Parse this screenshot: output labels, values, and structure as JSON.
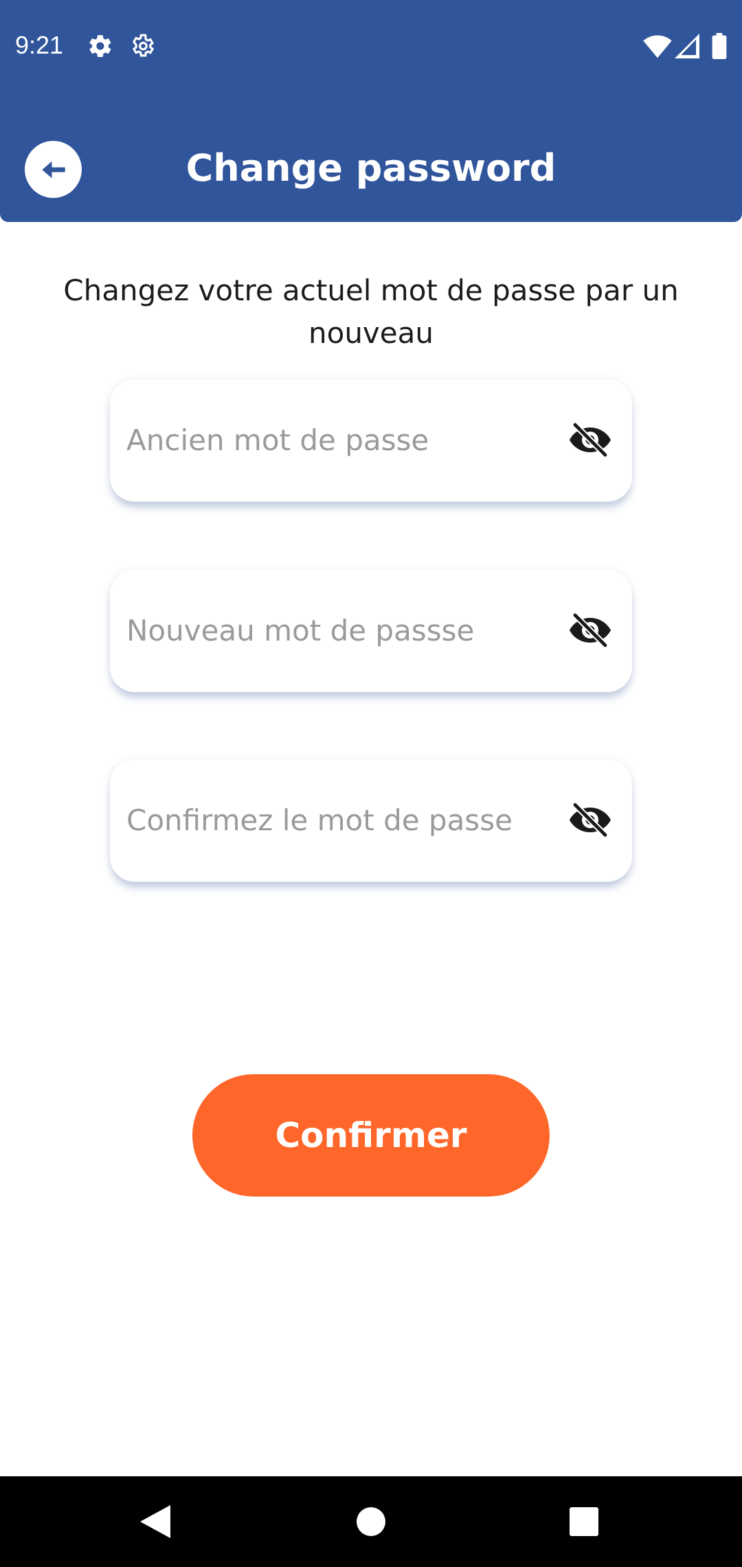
{
  "status_bar": {
    "time": "9:21",
    "left_icons": [
      "gear-icon",
      "settings-outline-icon"
    ],
    "right_icons": [
      "wifi-icon",
      "cellular-signal-icon",
      "battery-icon"
    ]
  },
  "header": {
    "title": "Change password",
    "back_icon": "arrow-left-circle-icon",
    "background_color": "#30559b"
  },
  "main": {
    "instruction": "Changez votre actuel mot de passe par un nouveau",
    "fields": [
      {
        "placeholder": "Ancien mot de passe",
        "value": "",
        "toggle_icon": "eye-off-icon"
      },
      {
        "placeholder": "Nouveau mot de passse",
        "value": "",
        "toggle_icon": "eye-off-icon"
      },
      {
        "placeholder": "Confirmez le mot de passe",
        "value": "",
        "toggle_icon": "eye-off-icon"
      }
    ],
    "confirm_label": "Confirmer",
    "confirm_color": "#ff6629"
  },
  "nav_bar": {
    "buttons": [
      "back-triangle-icon",
      "home-circle-icon",
      "recents-square-icon"
    ]
  }
}
